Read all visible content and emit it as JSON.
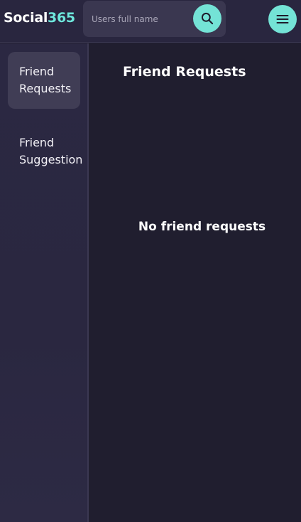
{
  "header": {
    "logo_text": "Social",
    "logo_accent": "365",
    "search_placeholder": "Users full name",
    "search_icon": "search-icon",
    "menu_icon": "hamburger-menu-icon"
  },
  "sidebar": {
    "items": [
      {
        "label": "Friend Requests",
        "active": true
      },
      {
        "label": "Friend Suggestion",
        "active": false
      }
    ]
  },
  "main": {
    "title": "Friend Requests",
    "empty_message": "No friend requests"
  },
  "colors": {
    "accent": "#74e3d6",
    "background": "#201e2f",
    "header": "#29263f",
    "sidebar_active": "#403d55"
  }
}
